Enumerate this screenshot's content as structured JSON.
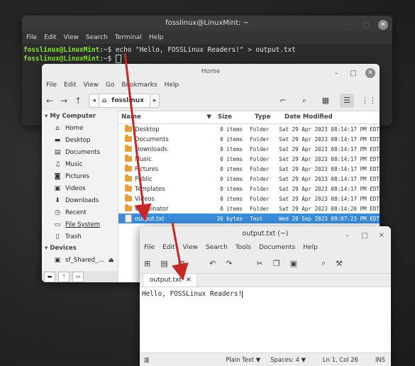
{
  "terminal": {
    "title": "fosslinux@LinuxMint: ~",
    "menu": [
      "File",
      "Edit",
      "View",
      "Search",
      "Terminal",
      "Help"
    ],
    "prompt": "fosslinux@LinuxMint",
    "path_suffix": ":~$",
    "command": " echo \"Hello, FOSSLinux Readers!\" > output.txt"
  },
  "files": {
    "title": "Home",
    "menu": [
      "File",
      "Edit",
      "View",
      "Go",
      "Bookmarks",
      "Help"
    ],
    "location": "fosslinux",
    "sidebar": {
      "computer_heading": "My Computer",
      "items": [
        {
          "label": "Home",
          "icon": "home-icon"
        },
        {
          "label": "Desktop",
          "icon": "desktop-icon"
        },
        {
          "label": "Documents",
          "icon": "documents-icon"
        },
        {
          "label": "Music",
          "icon": "music-icon"
        },
        {
          "label": "Pictures",
          "icon": "pictures-icon"
        },
        {
          "label": "Videos",
          "icon": "videos-icon"
        },
        {
          "label": "Downloads",
          "icon": "downloads-icon"
        },
        {
          "label": "Recent",
          "icon": "recent-icon"
        },
        {
          "label": "File System",
          "icon": "file-system-icon"
        },
        {
          "label": "Trash",
          "icon": "trash-icon"
        }
      ],
      "devices_heading": "Devices",
      "device": "sf_Shared_..."
    },
    "columns": [
      "Name",
      "Size",
      "Type",
      "Date Modified"
    ],
    "rows": [
      {
        "name": "Desktop",
        "size": "0 items",
        "type": "Folder",
        "date": "Sat 29 Apr 2023 08:14:17 PM EDT"
      },
      {
        "name": "Documents",
        "size": "0 items",
        "type": "Folder",
        "date": "Sat 29 Apr 2023 08:14:17 PM EDT"
      },
      {
        "name": "Downloads",
        "size": "0 items",
        "type": "Folder",
        "date": "Sat 29 Apr 2023 08:14:17 PM EDT"
      },
      {
        "name": "Music",
        "size": "0 items",
        "type": "Folder",
        "date": "Sat 29 Apr 2023 08:14:17 PM EDT"
      },
      {
        "name": "Pictures",
        "size": "0 items",
        "type": "Folder",
        "date": "Sat 29 Apr 2023 08:14:17 PM EDT"
      },
      {
        "name": "Public",
        "size": "0 items",
        "type": "Folder",
        "date": "Sat 29 Apr 2023 08:14:17 PM EDT"
      },
      {
        "name": "Templates",
        "size": "0 items",
        "type": "Folder",
        "date": "Sat 29 Apr 2023 08:14:17 PM EDT"
      },
      {
        "name": "Videos",
        "size": "0 items",
        "type": "Folder",
        "date": "Sat 29 Apr 2023 08:14:17 PM EDT"
      },
      {
        "name": "Wallpinator",
        "size": "0 items",
        "type": "Folder",
        "date": "Sat 29 Apr 2023 08:14:20 PM EDT"
      },
      {
        "name": "output.txt",
        "size": "26 bytes",
        "type": "Text",
        "date": "Wed 20 Sep 2023 09:07:23 PM EDT"
      }
    ]
  },
  "editor": {
    "title": "output.txt (~)",
    "menu": [
      "File",
      "Edit",
      "View",
      "Search",
      "Tools",
      "Documents",
      "Help"
    ],
    "tab_label": "output.txt",
    "content": "Hello, FOSSLinux Readers!",
    "status": {
      "syntax": "Plain Text",
      "spaces": "Spaces: 4",
      "position": "Ln 1, Col 26",
      "mode": "INS"
    }
  },
  "colors": {
    "selection": "#3a8bd9",
    "arrow": "#c62828",
    "prompt": "#8ae234"
  }
}
